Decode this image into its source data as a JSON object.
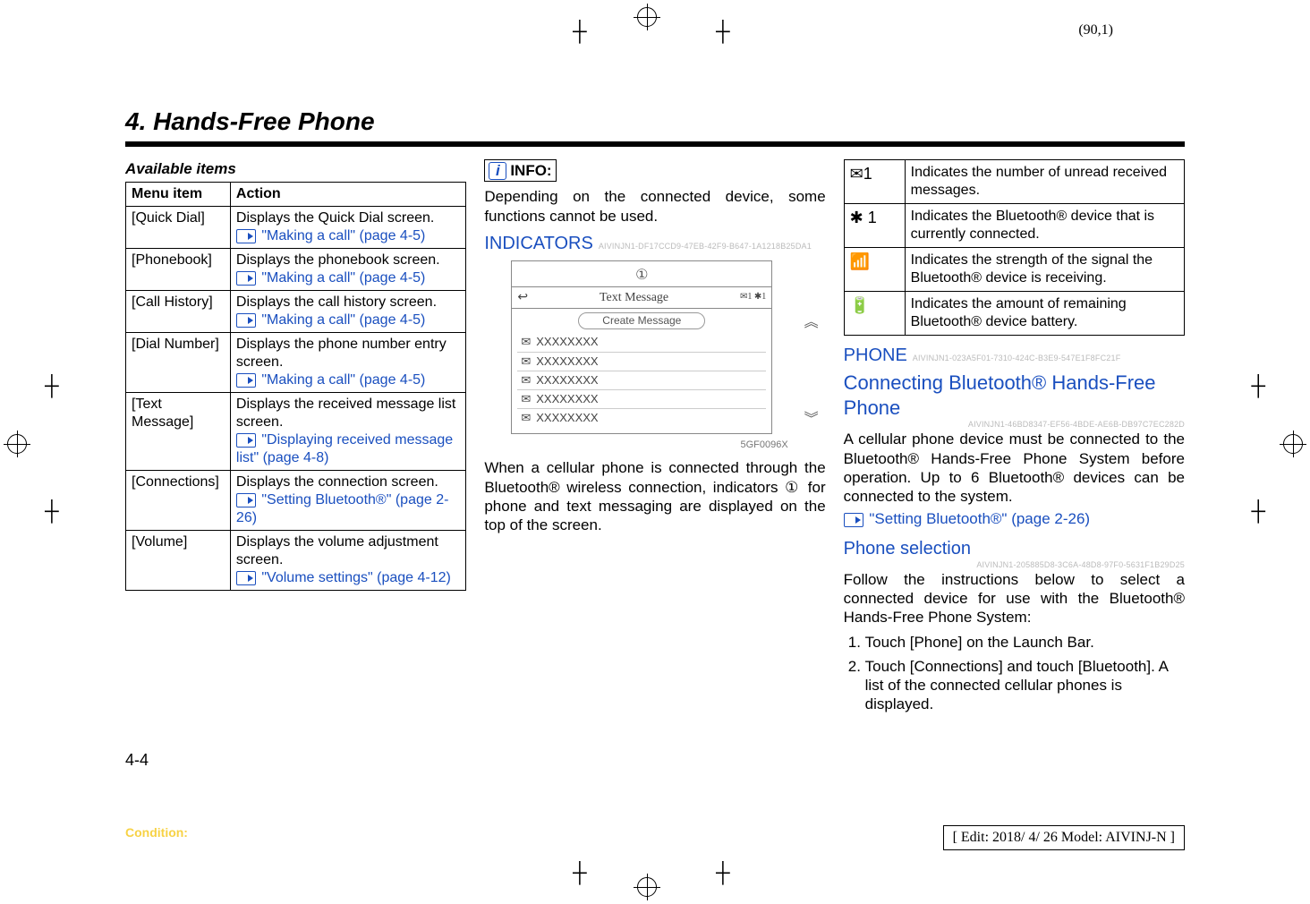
{
  "meta": {
    "pageTuple": "(90,1)"
  },
  "chapter": "4. Hands-Free Phone",
  "availableItemsHeading": "Available items",
  "tableHeaders": {
    "menu": "Menu item",
    "action": "Action"
  },
  "menu": [
    {
      "item": "[Quick Dial]",
      "action": "Displays the Quick Dial screen.",
      "linkText": "\"Making a call\" (page 4-5)"
    },
    {
      "item": "[Phonebook]",
      "action": "Displays the phonebook screen.",
      "linkText": "\"Making a call\" (page 4-5)"
    },
    {
      "item": "[Call History]",
      "action": "Displays the call history screen.",
      "linkText": "\"Making a call\" (page 4-5)"
    },
    {
      "item": "[Dial Number]",
      "action": "Displays the phone number entry screen.",
      "linkText": "\"Making a call\" (page 4-5)"
    },
    {
      "item": "[Text Message]",
      "action": "Displays the received message list screen.",
      "linkText": "\"Displaying received message list\" (page 4-8)"
    },
    {
      "item": "[Connections]",
      "action": "Displays the connection screen.",
      "linkText": "\"Setting Bluetooth®\" (page 2-26)"
    },
    {
      "item": "[Volume]",
      "action": "Displays the volume adjustment screen.",
      "linkText": "\"Volume settings\" (page 4-12)"
    }
  ],
  "info": {
    "label": "INFO:",
    "text": "Depending on the connected device, some functions cannot be used."
  },
  "indicators": {
    "heading": "INDICATORS",
    "hash": "AIVINJN1-DF17CCD9-47EB-42F9-B647-1A1218B25DA1",
    "fig": {
      "circled1": "①",
      "titlebar": "Text Message",
      "createBtn": "Create Message",
      "rows": [
        "XXXXXXXX",
        "XXXXXXXX",
        "XXXXXXXX",
        "XXXXXXXX",
        "XXXXXXXX"
      ]
    },
    "figCode": "5GF0096X",
    "bodyText": "When a cellular phone is connected through the Bluetooth® wireless connection, indicators ① for phone and text messaging are displayed on the top of the screen."
  },
  "indicatorTable": [
    {
      "iconText": "✉1",
      "iconName": "unread-messages-icon",
      "desc": "Indicates the number of unread received messages."
    },
    {
      "iconText": "✱ 1",
      "iconName": "bluetooth-device-icon",
      "desc": "Indicates the Bluetooth® device that is currently connected."
    },
    {
      "iconText": "📶",
      "iconName": "signal-strength-icon",
      "desc": "Indicates the strength of the signal the Bluetooth® device is receiving."
    },
    {
      "iconText": "🔋",
      "iconName": "battery-icon",
      "desc": "Indicates the amount of remaining Bluetooth® device battery."
    }
  ],
  "phone": {
    "heading": "PHONE",
    "headingHash": "AIVINJN1-023A5F01-7310-424C-B3E9-547E1F8FC21F",
    "connectHeading": "Connecting Bluetooth® Hands-Free Phone",
    "connectHash": "AIVINJN1-46BD8347-EF56-4BDE-AE6B-DB97C7EC282D",
    "connectText": "A cellular phone device must be connected to the Bluetooth® Hands-Free Phone System before operation. Up to 6 Bluetooth® devices can be connected to the system.",
    "connectLink": "\"Setting Bluetooth®\" (page 2-26)",
    "selectionHeading": "Phone selection",
    "selectionHash": "AIVINJN1-205885D8-3C6A-48D8-97F0-5631F1B29D25",
    "selectionText": "Follow the instructions below to select a connected device for use with the Bluetooth® Hands-Free Phone System:",
    "steps": [
      "Touch [Phone] on the Launch Bar.",
      "Touch [Connections] and touch [Bluetooth]. A list of the connected cellular phones is displayed."
    ]
  },
  "footer": {
    "pageNum": "4-4",
    "condition": "Condition:",
    "editBox": "[ Edit: 2018/ 4/ 26   Model: AIVINJ-N ]"
  }
}
